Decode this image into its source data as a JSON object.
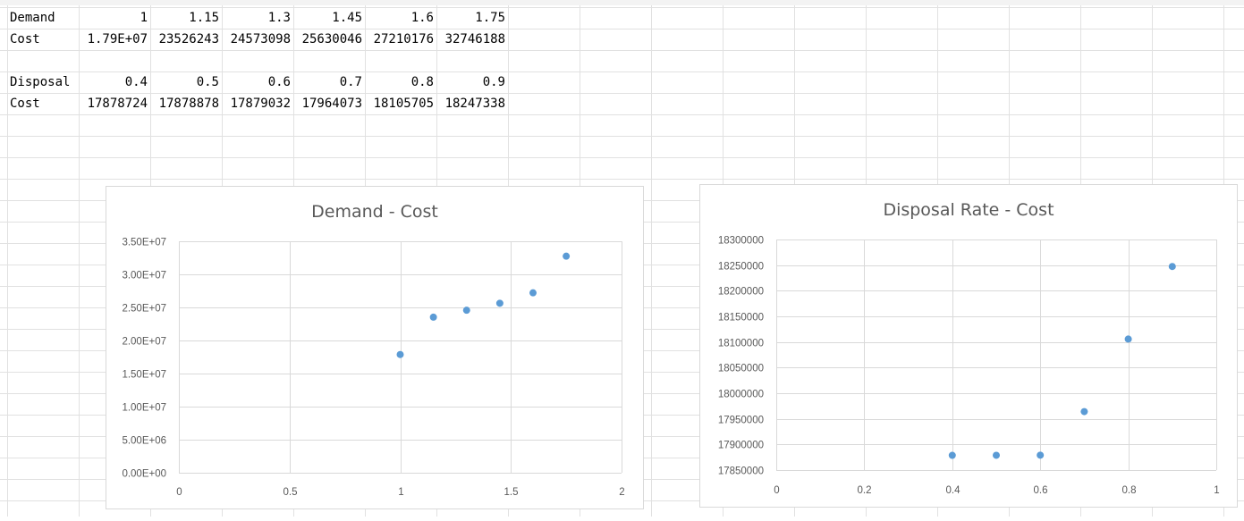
{
  "sheet": {
    "rows": [
      [
        "Demand",
        "1",
        "1.15",
        "1.3",
        "1.45",
        "1.6",
        "1.75"
      ],
      [
        "Cost",
        "1.79E+07",
        "23526243",
        "24573098",
        "25630046",
        "27210176",
        "32746188"
      ],
      [
        "",
        "",
        "",
        "",
        "",
        "",
        ""
      ],
      [
        "Disposal",
        "0.4",
        "0.5",
        "0.6",
        "0.7",
        "0.8",
        "0.9"
      ],
      [
        "Cost",
        "17878724",
        "17878878",
        "17879032",
        "17964073",
        "18105705",
        "18247338"
      ]
    ]
  },
  "chart_data": [
    {
      "type": "scatter",
      "title": "Demand - Cost",
      "xlabel": "",
      "ylabel": "",
      "xlim": [
        0,
        2
      ],
      "ylim": [
        0,
        35000000
      ],
      "x_ticks": [
        0,
        0.5,
        1,
        1.5,
        2
      ],
      "x_tick_labels": [
        "0",
        "0.5",
        "1",
        "1.5",
        "2"
      ],
      "y_ticks": [
        0,
        5000000,
        10000000,
        15000000,
        20000000,
        25000000,
        30000000,
        35000000
      ],
      "y_tick_labels": [
        "0.00E+00",
        "5.00E+06",
        "1.00E+07",
        "1.50E+07",
        "2.00E+07",
        "2.50E+07",
        "3.00E+07",
        "3.50E+07"
      ],
      "grid": true,
      "legend": "none",
      "series": [
        {
          "color": "#5b9bd5",
          "x": [
            1,
            1.15,
            1.3,
            1.45,
            1.6,
            1.75
          ],
          "y": [
            17878724,
            23526243,
            24573098,
            25630046,
            27210176,
            32746188
          ]
        }
      ]
    },
    {
      "type": "scatter",
      "title": "Disposal Rate - Cost",
      "xlabel": "",
      "ylabel": "",
      "xlim": [
        0,
        1
      ],
      "ylim": [
        17850000,
        18300000
      ],
      "x_ticks": [
        0,
        0.2,
        0.4,
        0.6,
        0.8,
        1
      ],
      "x_tick_labels": [
        "0",
        "0.2",
        "0.4",
        "0.6",
        "0.8",
        "1"
      ],
      "y_ticks": [
        17850000,
        17900000,
        17950000,
        18000000,
        18050000,
        18100000,
        18150000,
        18200000,
        18250000,
        18300000
      ],
      "y_tick_labels": [
        "17850000",
        "17900000",
        "17950000",
        "18000000",
        "18050000",
        "18100000",
        "18150000",
        "18200000",
        "18250000",
        "18300000"
      ],
      "grid": true,
      "legend": "none",
      "series": [
        {
          "color": "#5b9bd5",
          "x": [
            0.4,
            0.5,
            0.6,
            0.7,
            0.8,
            0.9
          ],
          "y": [
            17878724,
            17878878,
            17879032,
            17964073,
            18105705,
            18247338
          ]
        }
      ]
    }
  ]
}
